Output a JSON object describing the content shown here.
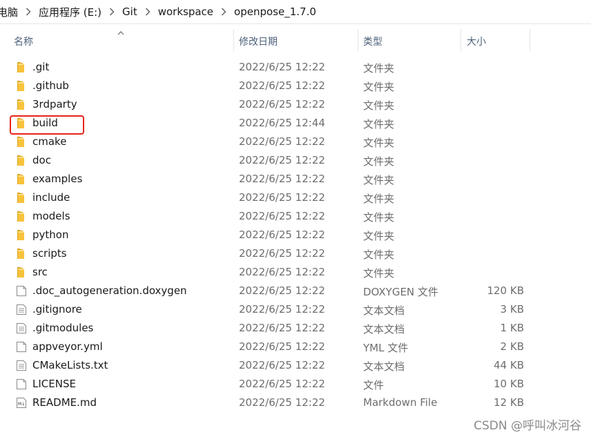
{
  "breadcrumb": {
    "items": [
      "电脑",
      "应用程序 (E:)",
      "Git",
      "workspace",
      "openpose_1.7.0"
    ]
  },
  "columns": {
    "name": "名称",
    "date": "修改日期",
    "type": "类型",
    "size": "大小"
  },
  "files": [
    {
      "name": ".git",
      "date": "2022/6/25 12:22",
      "type": "文件夹",
      "size": "",
      "icon": "folder-icon"
    },
    {
      "name": ".github",
      "date": "2022/6/25 12:22",
      "type": "文件夹",
      "size": "",
      "icon": "folder-icon"
    },
    {
      "name": "3rdparty",
      "date": "2022/6/25 12:22",
      "type": "文件夹",
      "size": "",
      "icon": "folder-icon"
    },
    {
      "name": "build",
      "date": "2022/6/25 12:44",
      "type": "文件夹",
      "size": "",
      "icon": "folder-icon"
    },
    {
      "name": "cmake",
      "date": "2022/6/25 12:22",
      "type": "文件夹",
      "size": "",
      "icon": "folder-icon"
    },
    {
      "name": "doc",
      "date": "2022/6/25 12:22",
      "type": "文件夹",
      "size": "",
      "icon": "folder-icon"
    },
    {
      "name": "examples",
      "date": "2022/6/25 12:22",
      "type": "文件夹",
      "size": "",
      "icon": "folder-icon"
    },
    {
      "name": "include",
      "date": "2022/6/25 12:22",
      "type": "文件夹",
      "size": "",
      "icon": "folder-icon"
    },
    {
      "name": "models",
      "date": "2022/6/25 12:22",
      "type": "文件夹",
      "size": "",
      "icon": "folder-icon"
    },
    {
      "name": "python",
      "date": "2022/6/25 12:22",
      "type": "文件夹",
      "size": "",
      "icon": "folder-icon"
    },
    {
      "name": "scripts",
      "date": "2022/6/25 12:22",
      "type": "文件夹",
      "size": "",
      "icon": "folder-icon"
    },
    {
      "name": "src",
      "date": "2022/6/25 12:22",
      "type": "文件夹",
      "size": "",
      "icon": "folder-icon"
    },
    {
      "name": ".doc_autogeneration.doxygen",
      "date": "2022/6/25 12:22",
      "type": "DOXYGEN 文件",
      "size": "120 KB",
      "icon": "file-icon"
    },
    {
      "name": ".gitignore",
      "date": "2022/6/25 12:22",
      "type": "文本文档",
      "size": "3 KB",
      "icon": "text-file-icon"
    },
    {
      "name": ".gitmodules",
      "date": "2022/6/25 12:22",
      "type": "文本文档",
      "size": "1 KB",
      "icon": "text-file-icon"
    },
    {
      "name": "appveyor.yml",
      "date": "2022/6/25 12:22",
      "type": "YML 文件",
      "size": "2 KB",
      "icon": "file-icon"
    },
    {
      "name": "CMakeLists.txt",
      "date": "2022/6/25 12:22",
      "type": "文本文档",
      "size": "44 KB",
      "icon": "text-file-icon"
    },
    {
      "name": "LICENSE",
      "date": "2022/6/25 12:22",
      "type": "文件",
      "size": "10 KB",
      "icon": "file-icon"
    },
    {
      "name": "README.md",
      "date": "2022/6/25 12:22",
      "type": "Markdown File",
      "size": "12 KB",
      "icon": "markdown-file-icon"
    }
  ],
  "highlighted_item": "build",
  "watermark": "CSDN @呼叫冰河谷",
  "colors": {
    "folder": "#f8c33c",
    "highlight_box": "#e8231a",
    "header_text": "#4c607a"
  }
}
